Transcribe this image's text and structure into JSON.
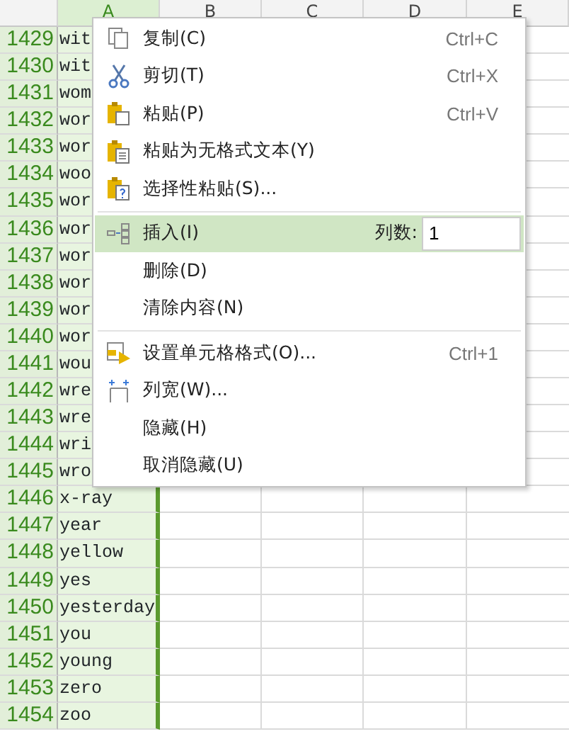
{
  "columns": [
    {
      "label": "A",
      "selected": true
    },
    {
      "label": "B",
      "selected": false
    },
    {
      "label": "C",
      "selected": false
    },
    {
      "label": "D",
      "selected": false
    },
    {
      "label": "E",
      "selected": false
    }
  ],
  "rows": [
    {
      "number": "1429",
      "cell": "wit"
    },
    {
      "number": "1430",
      "cell": "wit"
    },
    {
      "number": "1431",
      "cell": "wom"
    },
    {
      "number": "1432",
      "cell": "wor"
    },
    {
      "number": "1433",
      "cell": "wor"
    },
    {
      "number": "1434",
      "cell": "woo"
    },
    {
      "number": "1435",
      "cell": "wor"
    },
    {
      "number": "1436",
      "cell": "wor"
    },
    {
      "number": "1437",
      "cell": "wor"
    },
    {
      "number": "1438",
      "cell": "wor"
    },
    {
      "number": "1439",
      "cell": "wor"
    },
    {
      "number": "1440",
      "cell": "wor"
    },
    {
      "number": "1441",
      "cell": "wou"
    },
    {
      "number": "1442",
      "cell": "wre"
    },
    {
      "number": "1443",
      "cell": "wre"
    },
    {
      "number": "1444",
      "cell": "wri"
    },
    {
      "number": "1445",
      "cell": "wro"
    },
    {
      "number": "1446",
      "cell": "x-ray"
    },
    {
      "number": "1447",
      "cell": "year"
    },
    {
      "number": "1448",
      "cell": "yellow"
    },
    {
      "number": "1449",
      "cell": "yes"
    },
    {
      "number": "1450",
      "cell": "yesterday"
    },
    {
      "number": "1451",
      "cell": "you"
    },
    {
      "number": "1452",
      "cell": "young"
    },
    {
      "number": "1453",
      "cell": "zero"
    },
    {
      "number": "1454",
      "cell": "zoo"
    }
  ],
  "context_menu": [
    {
      "kind": "item",
      "label": "复制(C)",
      "shortcut": "Ctrl+C",
      "selected": false
    },
    {
      "kind": "item",
      "label": "剪切(T)",
      "shortcut": "Ctrl+X",
      "selected": false
    },
    {
      "kind": "item",
      "label": "粘贴(P)",
      "shortcut": "Ctrl+V",
      "selected": false
    },
    {
      "kind": "item",
      "label": "粘贴为无格式文本(Y)",
      "selected": false
    },
    {
      "kind": "item",
      "label": "选择性粘贴(S)...",
      "selected": false
    },
    {
      "kind": "separator"
    },
    {
      "kind": "input",
      "label": "插入(I)",
      "field_label": "列数:",
      "value": "1",
      "selected": true
    },
    {
      "kind": "item",
      "label": "删除(D)",
      "selected": false
    },
    {
      "kind": "item",
      "label": "清除内容(N)",
      "selected": false
    },
    {
      "kind": "separator"
    },
    {
      "kind": "item",
      "label": "设置单元格格式(O)...",
      "shortcut": "Ctrl+1",
      "selected": false
    },
    {
      "kind": "item",
      "label": "列宽(W)...",
      "selected": false
    },
    {
      "kind": "item",
      "label": "隐藏(H)",
      "selected": false
    },
    {
      "kind": "item",
      "label": "取消隐藏(U)",
      "selected": false
    }
  ]
}
